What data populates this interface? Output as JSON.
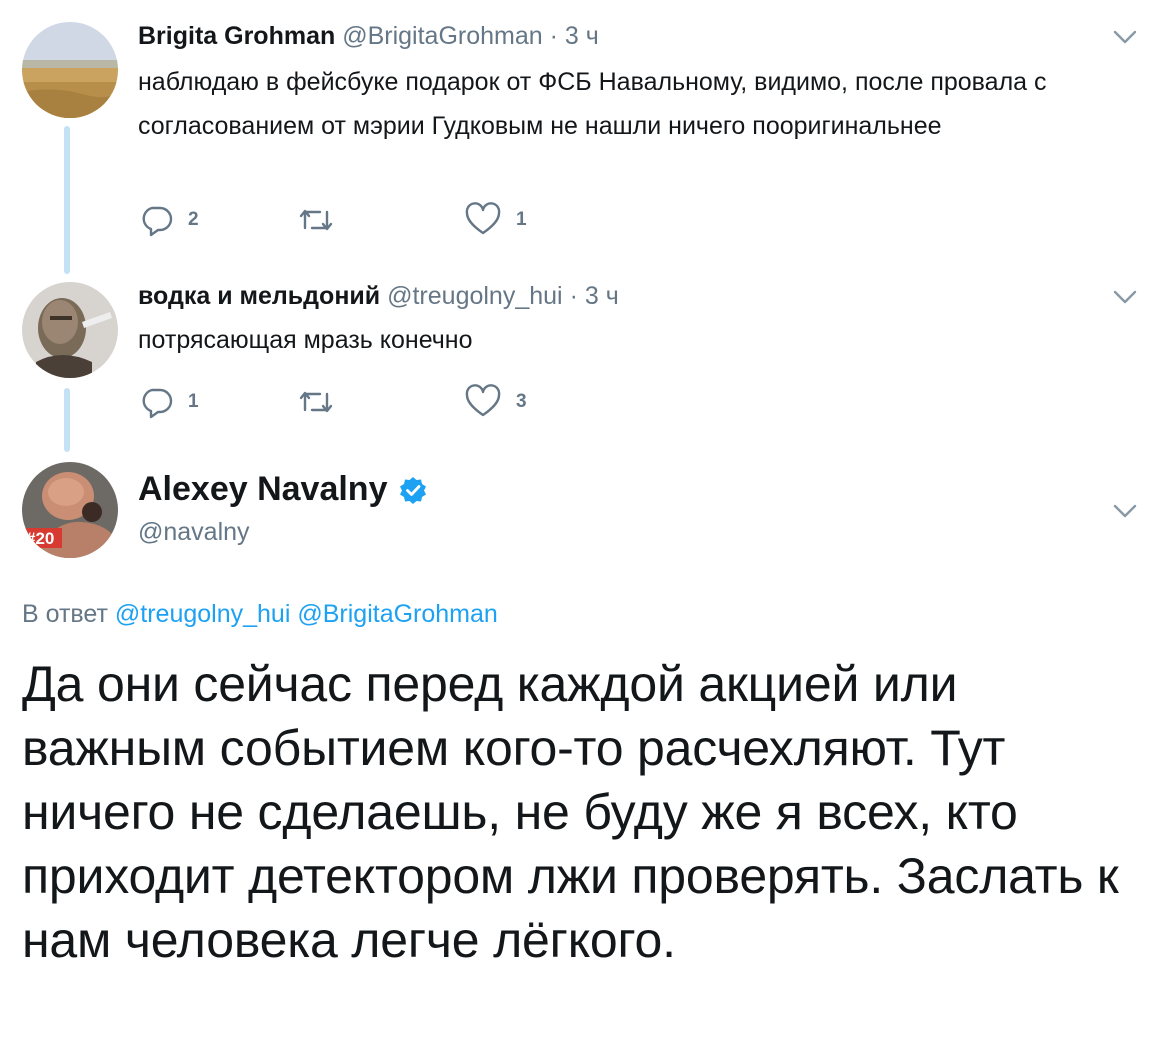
{
  "tweets": [
    {
      "name": "Brigita Grohman",
      "handle": "@BrigitaGrohman",
      "dot": "·",
      "time": "3 ч",
      "text": "наблюдаю в фейсбуке подарок от ФСБ Навальному, видимо, после провала с согласованием от мэрии Гудковым не нашли ничего пооригинальнее",
      "replies": "2",
      "likes": "1"
    },
    {
      "name": "водка и мельдоний",
      "handle": "@treugolny_hui",
      "dot": "·",
      "time": "3 ч",
      "text": "потрясающая мразь конечно",
      "replies": "1",
      "likes": "3"
    }
  ],
  "main_tweet": {
    "name": "Alexey Navalny",
    "handle": "@navalny",
    "avatar_badge": "#20",
    "reply_prefix": "В ответ",
    "reply_to_1": "@treugolny_hui",
    "reply_to_2": "@BrigitaGrohman",
    "text": "Да они сейчас перед каждой акцией или важным событием кого-то расчехляют. Тут ничего не сделаешь, не буду же я всех, кто приходит детектором лжи проверять. Заслать к нам человека легче лёгкого."
  },
  "colors": {
    "text": "#14171a",
    "secondary": "#657786",
    "link": "#1da1f2",
    "thread_line": "#c4e1f6"
  }
}
